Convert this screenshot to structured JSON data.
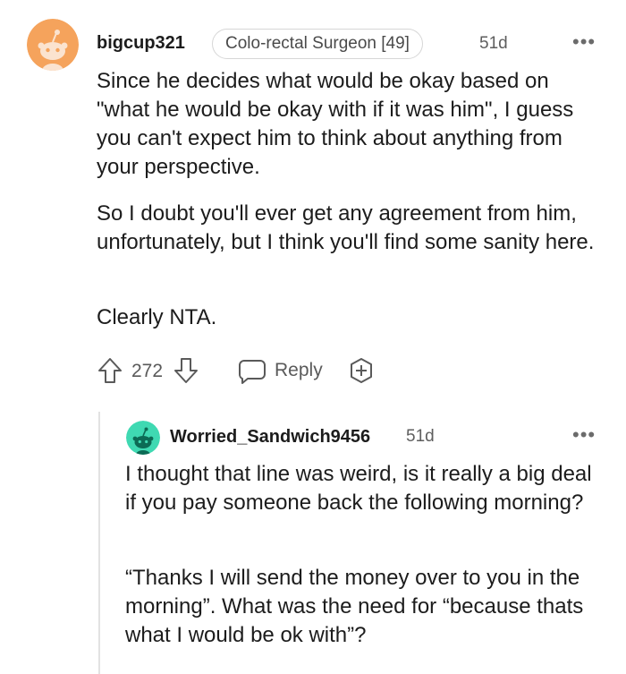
{
  "comment": {
    "username": "bigcup321",
    "flair": "Colo-rectal Surgeon [49]",
    "age": "51d",
    "paragraphs": [
      "Since he decides what would be okay based on \"what he would be okay with if it was him\", I guess you can't expect him to think about anything from your perspective.",
      "So I doubt you'll ever get any agreement from him, unfortunately, but I think you'll find some sanity here.",
      "Clearly NTA."
    ],
    "votes": "272",
    "reply_label": "Reply",
    "avatar_color": "#f5a35c"
  },
  "reply": {
    "username": "Worried_Sandwich9456",
    "age": "51d",
    "paragraphs": [
      "I thought that line was weird, is it really a big deal if you pay someone back the following morning?",
      "“Thanks I will send the money over to you in the morning”. What was the need for “because thats what I would be ok with”?"
    ],
    "avatar_color": "#3fd9b2"
  },
  "icons": {
    "upvote": "arrow-up-icon",
    "downvote": "arrow-down-icon",
    "reply": "speech-bubble-icon",
    "award": "plus-circle-icon",
    "more": "more-dots-icon"
  }
}
